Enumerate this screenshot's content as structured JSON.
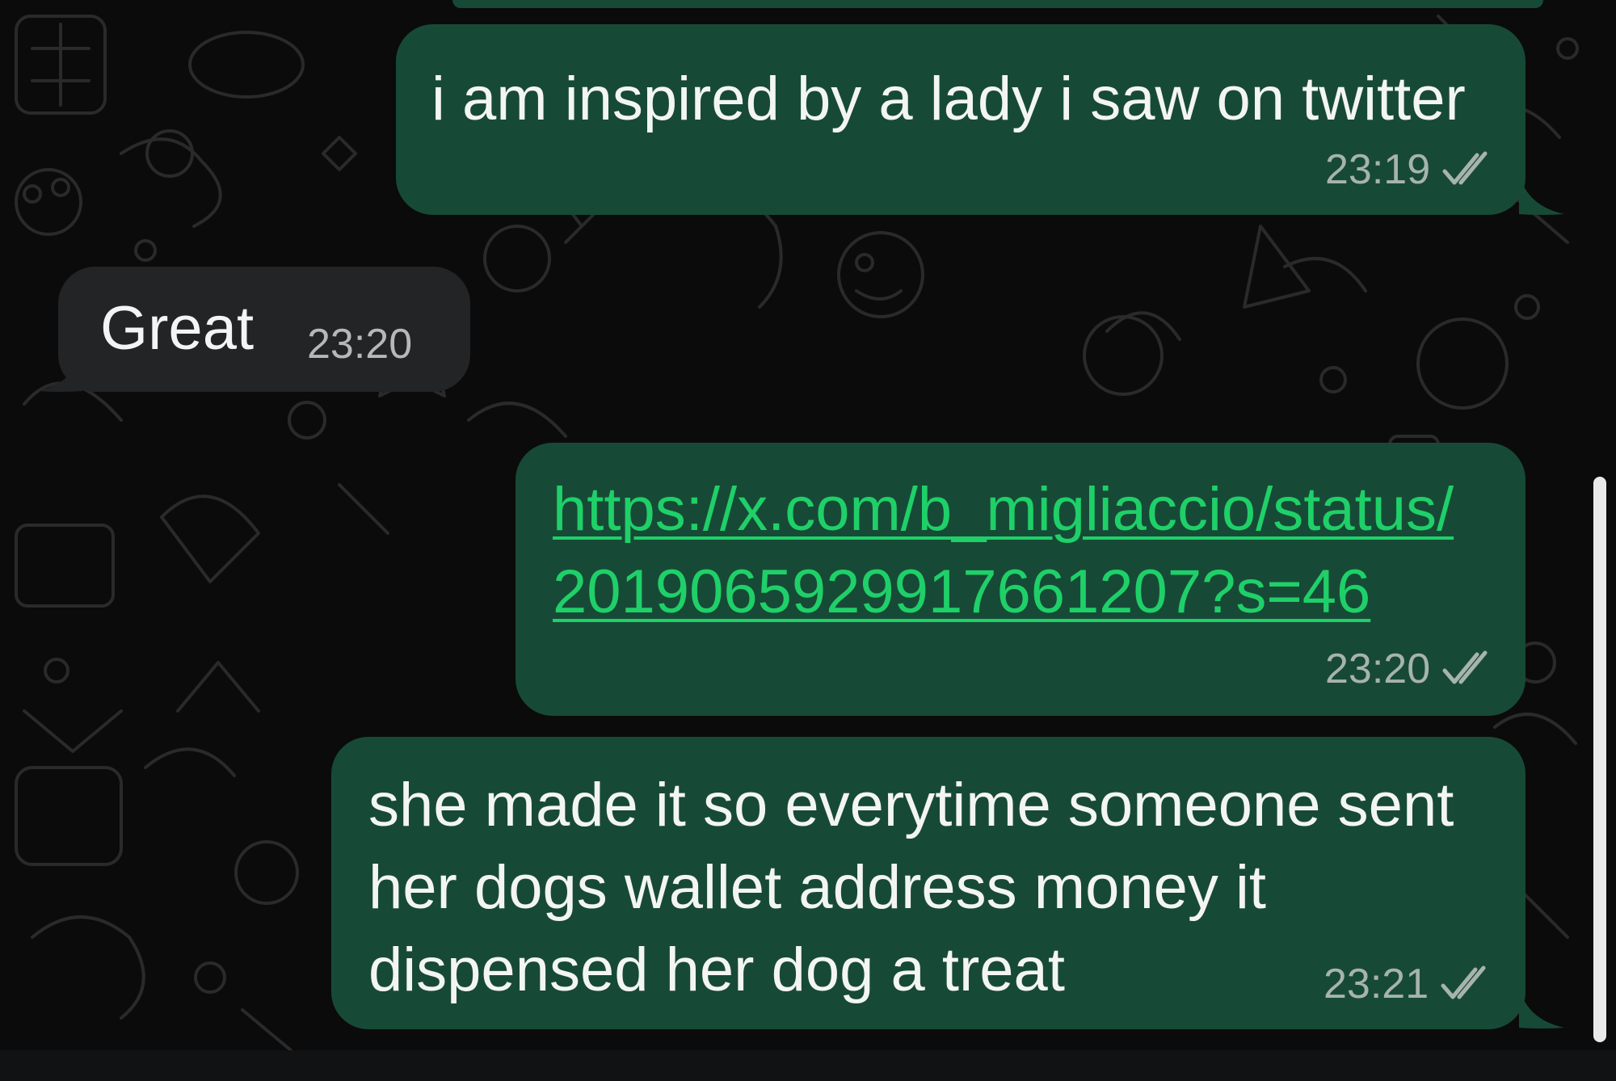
{
  "colors": {
    "background": "#0b0b0b",
    "outgoing_bubble": "#174a36",
    "incoming_bubble": "#232426",
    "link": "#1fd069",
    "text": "#f3f5f4",
    "timestamp": "#a7b3ad"
  },
  "messages": [
    {
      "direction": "outgoing",
      "text": "i am inspired by a lady i saw on twitter",
      "time": "23:19",
      "status_icon": "double-check-icon"
    },
    {
      "direction": "incoming",
      "text": "Great",
      "time": "23:20"
    },
    {
      "direction": "outgoing",
      "link_line_1": "https://x.com/b_migliaccio/status/",
      "link_line_2": "2019065929917661207?s=46",
      "time": "23:20",
      "status_icon": "double-check-icon"
    },
    {
      "direction": "outgoing",
      "line_1": "she made it so everytime someone sent",
      "line_2": "her dogs wallet address money it",
      "line_3": "dispensed her dog a treat",
      "time": "23:21",
      "status_icon": "double-check-icon"
    }
  ]
}
